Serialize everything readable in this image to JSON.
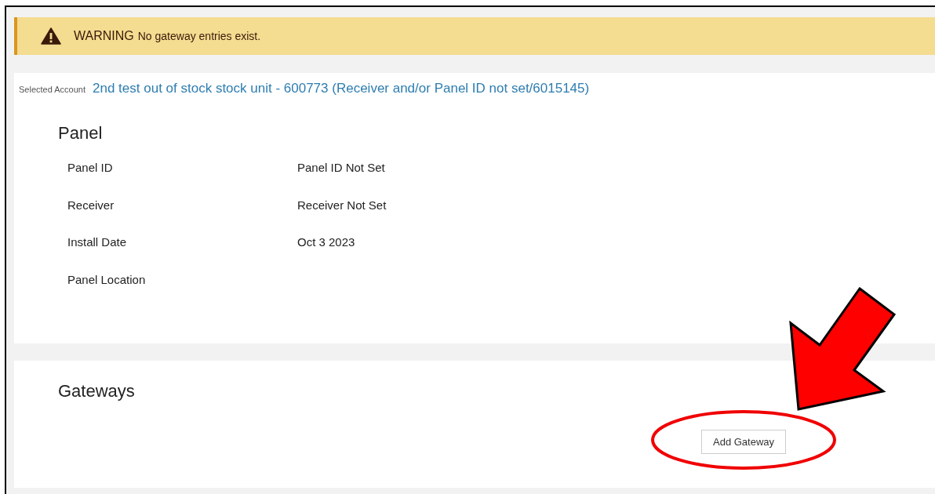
{
  "warning": {
    "label": "WARNING",
    "message": "No gateway entries exist."
  },
  "account": {
    "label": "Selected Account",
    "value": "2nd test out of stock stock unit - 600773 (Receiver and/or Panel ID not set/6015145)"
  },
  "panel": {
    "title": "Panel",
    "fields": [
      {
        "label": "Panel ID",
        "value": "Panel ID Not Set"
      },
      {
        "label": "Receiver",
        "value": "Receiver Not Set"
      },
      {
        "label": "Install Date",
        "value": "Oct 3 2023"
      },
      {
        "label": "Panel Location"
      }
    ]
  },
  "gateways": {
    "title": "Gateways",
    "button": "Add Gateway"
  }
}
